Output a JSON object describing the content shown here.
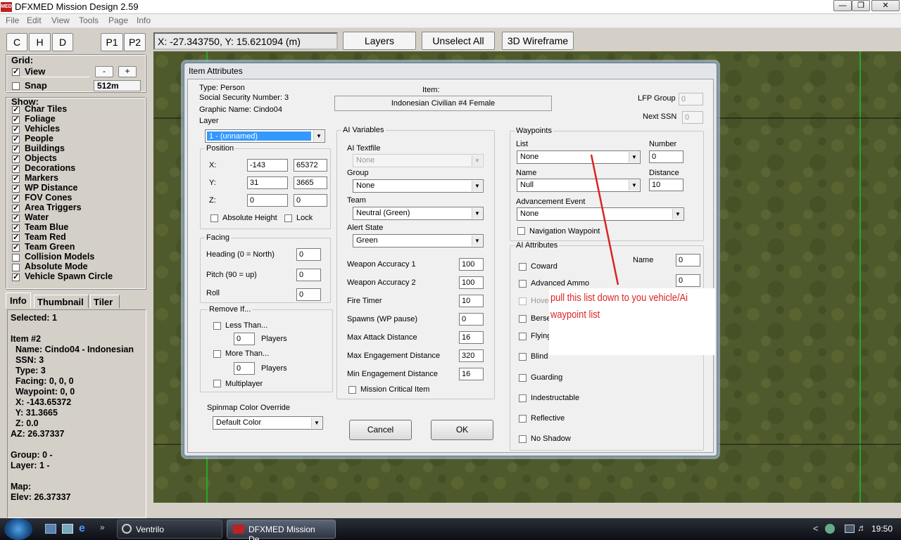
{
  "window": {
    "title": "DFXMED Mission Design 2.59",
    "icon": "MED"
  },
  "menu": [
    "File",
    "Edit",
    "View",
    "Tools",
    "Page",
    "Info"
  ],
  "left_buttons": [
    "C",
    "H",
    "D",
    "P1",
    "P2"
  ],
  "toolbar": {
    "coords": "X: -27.343750, Y: 15.621094 (m)",
    "layers": "Layers",
    "unselect_all": "Unselect All",
    "wireframe": "3D Wireframe"
  },
  "grid": {
    "label": "Grid:",
    "view": "View",
    "minus": "-",
    "plus": "+",
    "snap": "Snap",
    "snap_value": "512m"
  },
  "show": {
    "label": "Show:",
    "items": [
      {
        "label": "Char Tiles",
        "checked": "✓"
      },
      {
        "label": "Foliage",
        "checked": "✓"
      },
      {
        "label": "Vehicles",
        "checked": "✓"
      },
      {
        "label": "People",
        "checked": "✓"
      },
      {
        "label": "Buildings",
        "checked": "✓"
      },
      {
        "label": "Objects",
        "checked": "✓"
      },
      {
        "label": "Decorations",
        "checked": "✓"
      },
      {
        "label": "Markers",
        "checked": "✓"
      },
      {
        "label": "WP Distance",
        "checked": "✓"
      },
      {
        "label": "FOV Cones",
        "checked": "✓"
      },
      {
        "label": "Area Triggers",
        "checked": "✓"
      },
      {
        "label": "Water",
        "checked": "✓"
      },
      {
        "label": "Team Blue",
        "checked": "✓"
      },
      {
        "label": "Team Red",
        "checked": "✓"
      },
      {
        "label": "Team Green",
        "checked": "✓"
      },
      {
        "label": "Collision Models",
        "checked": ""
      },
      {
        "label": "Absolute Mode",
        "checked": ""
      },
      {
        "label": "Vehicle Spawn Circle",
        "checked": "✓"
      }
    ]
  },
  "info_tabs": [
    "Info",
    "Thumbnail",
    "Tiler"
  ],
  "info": {
    "lines": [
      "Selected: 1",
      "",
      "Item #2",
      "  Name: Cindo04 - Indonesian",
      "  SSN: 3",
      "  Type: 3",
      "  Facing: 0, 0, 0",
      "  Waypoint: 0, 0",
      "  X: -143.65372",
      "  Y: 31.3665",
      "  Z: 0.0",
      "AZ: 26.37337",
      "",
      "Group: 0 -",
      "Layer: 1 -",
      "",
      "Map:",
      "Elev: 26.37337"
    ]
  },
  "dialog": {
    "title": "Item Attributes",
    "type": "Type: Person",
    "ssn": "Social Security Number: 3",
    "graphic": "Graphic Name: Cindo04",
    "layer_label": "Layer",
    "layer_value": "1 - (unnamed)",
    "item_label": "Item:",
    "item_value": "Indonesian Civilian #4 Female",
    "lfp_label": "LFP Group",
    "lfp_value": "0",
    "next_ssn_label": "Next SSN",
    "next_ssn_value": "0",
    "position": {
      "caption": "Position",
      "x_label": "X:",
      "x1": "-143",
      "x2": "65372",
      "y_label": "Y:",
      "y1": "31",
      "y2": "3665",
      "z_label": "Z:",
      "z1": "0",
      "z2": "0",
      "abs_height": "Absolute Height",
      "lock": "Lock"
    },
    "facing": {
      "caption": "Facing",
      "heading": "Heading (0 = North)",
      "heading_val": "0",
      "pitch": "Pitch (90 = up)",
      "pitch_val": "0",
      "roll": "Roll",
      "roll_val": "0"
    },
    "remove": {
      "caption": "Remove If...",
      "less": "Less Than...",
      "less_val": "0",
      "players1": "Players",
      "more": "More Than...",
      "more_val": "0",
      "players2": "Players",
      "multi": "Multiplayer"
    },
    "spinmap": {
      "label": "Spinmap Color Override",
      "value": "Default Color"
    },
    "ai": {
      "caption": "AI Variables",
      "textfile": "AI Textfile",
      "textfile_val": "None",
      "group": "Group",
      "group_val": "None",
      "team": "Team",
      "team_val": "Neutral (Green)",
      "alert": "Alert State",
      "alert_val": "Green",
      "rows": [
        {
          "label": "Weapon Accuracy 1",
          "value": "100"
        },
        {
          "label": "Weapon Accuracy 2",
          "value": "100"
        },
        {
          "label": "Fire Timer",
          "value": "10"
        },
        {
          "label": "Spawns (WP pause)",
          "value": "0"
        },
        {
          "label": "Max Attack Distance",
          "value": "16"
        },
        {
          "label": "Max Engagement Distance",
          "value": "320"
        },
        {
          "label": "Min Engagement Distance",
          "value": "16"
        }
      ],
      "critical": "Mission Critical Item"
    },
    "waypoints": {
      "caption": "Waypoints",
      "list": "List",
      "list_val": "None",
      "number": "Number",
      "number_val": "0",
      "name": "Name",
      "name_val": "Null",
      "distance": "Distance",
      "distance_val": "10",
      "adv": "Advancement Event",
      "adv_val": "None",
      "nav": "Navigation Waypoint"
    },
    "attrs": {
      "caption": "AI Attributes",
      "name": "Name",
      "name_val": "0",
      "val2": "0",
      "items": [
        "Coward",
        "Advanced Ammo",
        "Hover",
        "Berserk",
        "Flying",
        "Blind",
        "Guarding",
        "Indestructable",
        "Reflective",
        "No Shadow"
      ],
      "visible": [
        "Coward",
        "Advanced Ammo",
        "Hover",
        "Berser",
        "Flying",
        "Blind",
        "Guarding",
        "Indestructable",
        "Reflective",
        "No Shadow"
      ]
    },
    "cancel": "Cancel",
    "ok": "OK"
  },
  "annotation": "pull this list down to you vehicle/Ai waypoint list",
  "taskbar": {
    "ventrilo": "Ventrilo",
    "dfxmed": "DFXMED Mission De...",
    "time": "19:50"
  },
  "colors": {
    "annotation": "#dd2222",
    "map": "#4f5a2c",
    "grid_line": "#1fbf2a"
  }
}
